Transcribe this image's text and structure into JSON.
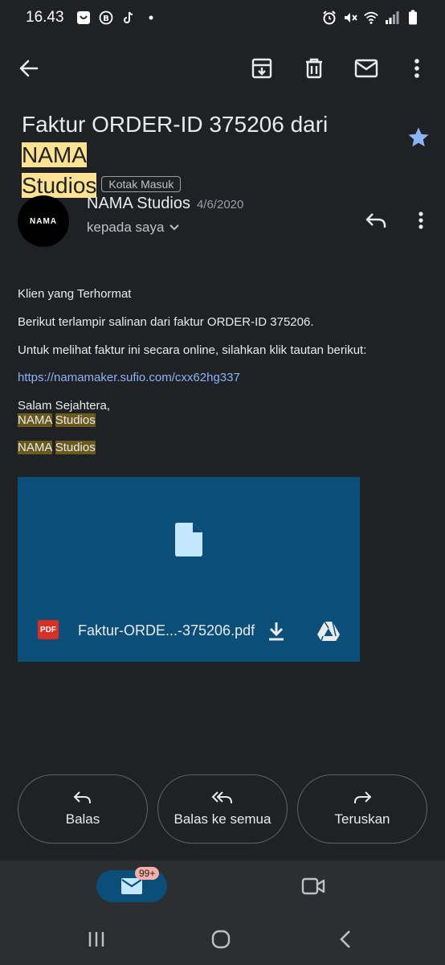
{
  "status_bar": {
    "time": "16.43",
    "left_icons": [
      "shopee-icon",
      "b-icon",
      "tiktok-icon",
      "dot-icon"
    ],
    "right_icons": [
      "alarm-icon",
      "mute-icon",
      "wifi-icon",
      "signal-icon",
      "battery-icon"
    ]
  },
  "toolbar": {
    "icons": [
      "back-arrow-icon",
      "archive-icon",
      "delete-icon",
      "mark-unread-icon",
      "more-vert-icon"
    ]
  },
  "email": {
    "subject_prefix": "Faktur ORDER-ID 375206 dari ",
    "subject_highlight_1": "NAMA",
    "subject_highlight_2": "Studios",
    "label": "Kotak Masuk",
    "starred": true,
    "star_color": "#8ab4f8",
    "sender": {
      "avatar_text": "NAMA",
      "name": "NAMA Studios",
      "date": "4/6/2020",
      "recipient": "kepada saya"
    },
    "body": {
      "greeting": "Klien yang Terhormat",
      "line1": "Berikut terlampir salinan dari faktur ORDER-ID 375206.",
      "line2": "Untuk melihat faktur ini secara online, silahkan klik tautan berikut:",
      "link": "https://namamaker.sufio.com/cxx62hg337",
      "closing": "Salam Sejahtera,",
      "sig1_a": "NAMA",
      "sig1_b": "Studios",
      "sig2_a": "NAMA",
      "sig2_b": "Studios"
    },
    "attachment": {
      "type_badge": "PDF",
      "file_name": "Faktur-ORDE...-375206.pdf",
      "bg_color": "#0b4f78"
    }
  },
  "actions": {
    "reply": "Balas",
    "reply_all": "Balas ke semua",
    "forward": "Teruskan"
  },
  "bottom_nav": {
    "mail_badge": "99+",
    "items": [
      "mail-icon",
      "video-icon"
    ]
  },
  "system_nav": [
    "recents-icon",
    "home-icon",
    "back-icon"
  ]
}
